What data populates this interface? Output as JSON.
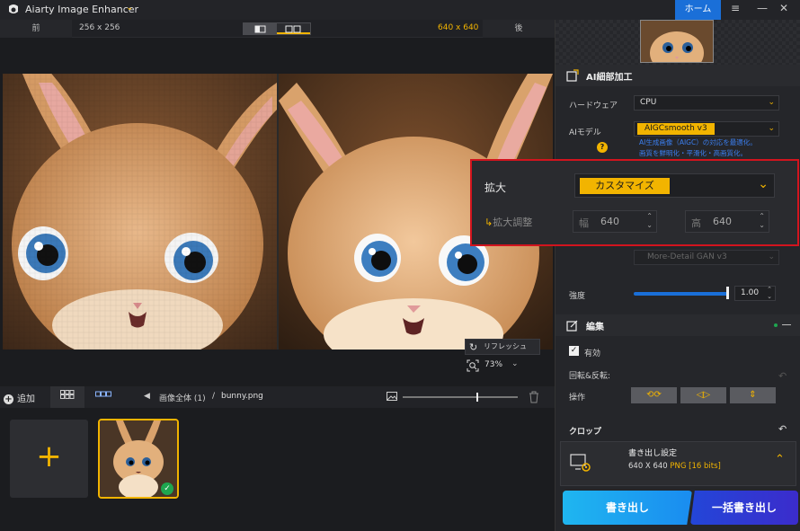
{
  "app": {
    "title": "Aiarty Image Enhancer",
    "home_label": "ホーム"
  },
  "compare": {
    "before_label": "前",
    "before_size": "256 x 256",
    "after_size": "640 x 640",
    "after_label": "後"
  },
  "preview": {
    "refresh_label": "リフレッシュ",
    "zoom": "73%"
  },
  "filebar": {
    "add_label": "追加",
    "breadcrumb_all": "画像全体 (1)",
    "breadcrumb_sep": "/",
    "filename": "bunny.png"
  },
  "panel": {
    "ai_section_title": "AI細部加工",
    "hardware_label": "ハードウェア",
    "hardware_value": "CPU",
    "model_label": "AIモデル",
    "model_value": "AIGCsmooth  v3",
    "model_desc_line1": "AI生成画像（AIGC）の対応を最適化。",
    "model_desc_line2": "画質を鮮明化・平滑化・高画質化。",
    "gan_value": "More-Detail GAN  v3",
    "strength_label": "強度",
    "strength_value": "1.00",
    "strength_level": 0.55,
    "edit_section_title": "編集",
    "enabled_label": "有効",
    "rotate_label": "回転&反転:",
    "operation_label": "操作",
    "crop_label": "クロップ",
    "export_title": "書き出し設定",
    "export_size": "640 X 640",
    "export_format": "PNG",
    "export_bits": "[16 bits]",
    "export_btn": "書き出し",
    "batch_btn": "一括書き出し"
  },
  "upscale": {
    "label": "拡大",
    "value": "カスタマイズ",
    "sub_label": "拡大調整",
    "width_label": "幅",
    "width_value": "640",
    "height_label": "高",
    "height_value": "640"
  },
  "colors": {
    "accent": "#f2b400",
    "primary": "#1a6fd8",
    "highlight": "#d2141e"
  }
}
